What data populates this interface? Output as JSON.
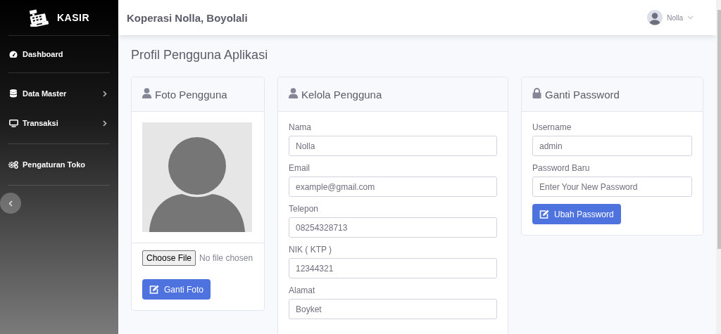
{
  "sidebar": {
    "brand": "KASIR",
    "sections": [
      [
        {
          "label": "Dashboard",
          "expandable": false
        }
      ],
      [
        {
          "label": "Data Master",
          "expandable": true
        },
        {
          "label": "Transaksi",
          "expandable": true
        }
      ],
      [
        {
          "label": "Pengaturan Toko",
          "expandable": false
        }
      ]
    ]
  },
  "topbar": {
    "title": "Koperasi Nolla, Boyolali",
    "user": "Nolla"
  },
  "page_title": "Profil Pengguna Aplikasi",
  "photo_card": {
    "title": "Foto Pengguna",
    "file_button": "Choose File",
    "file_status": "No file chosen",
    "button": "Ganti Foto"
  },
  "user_card": {
    "title": "Kelola Pengguna",
    "fields": [
      {
        "label": "Nama",
        "value": "Nolla"
      },
      {
        "label": "Email",
        "value": "example@gmail.com"
      },
      {
        "label": "Telepon",
        "value": "08254328713"
      },
      {
        "label": "NIK ( KTP )",
        "value": "12344321"
      },
      {
        "label": "Alamat",
        "value": "Boyket"
      }
    ]
  },
  "password_card": {
    "title": "Ganti Password",
    "fields": [
      {
        "label": "Username",
        "value": "admin"
      },
      {
        "label": "Password Baru",
        "placeholder": "Enter Your New Password"
      }
    ],
    "button": "Ubah Password"
  }
}
